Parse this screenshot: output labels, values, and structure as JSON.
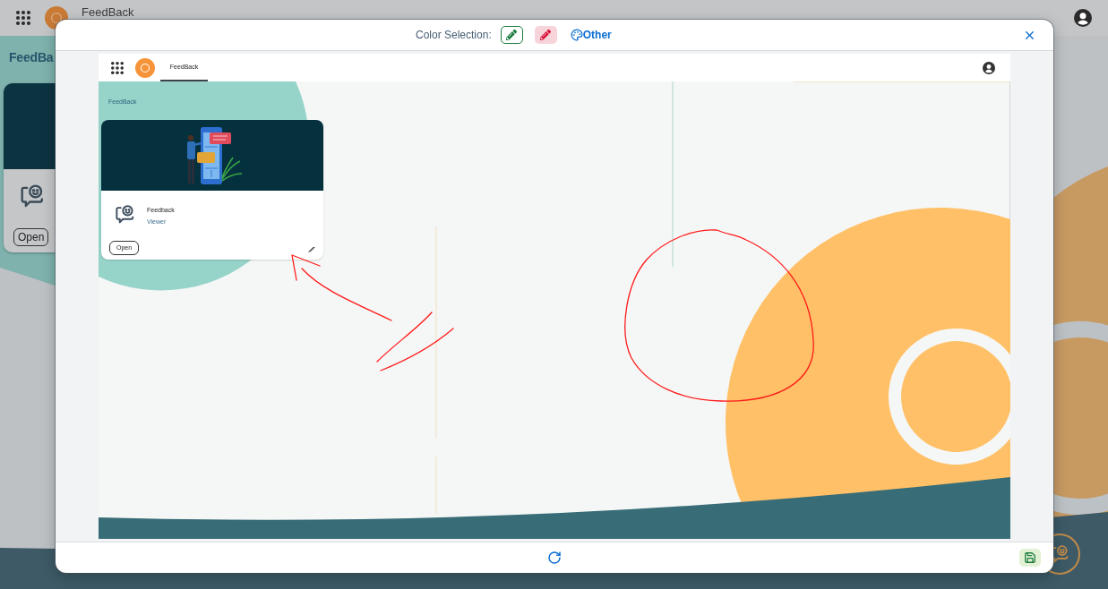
{
  "background_app": {
    "title": "FeedBack",
    "heading": "FeedBa",
    "card": {
      "button": "Open"
    }
  },
  "dialog": {
    "color_label": "Color Selection:",
    "colors": [
      {
        "color": "#1b7b3f",
        "selected": false
      },
      {
        "color": "#d6143a",
        "selected": true
      }
    ],
    "other_button": "Other"
  },
  "screenshot": {
    "tabs": [
      {
        "label": "FeedBack",
        "selected": true
      }
    ],
    "heading": "FeedBack",
    "card": {
      "title": "Feedback",
      "subtitle": "Viewer",
      "button": "Open"
    }
  }
}
